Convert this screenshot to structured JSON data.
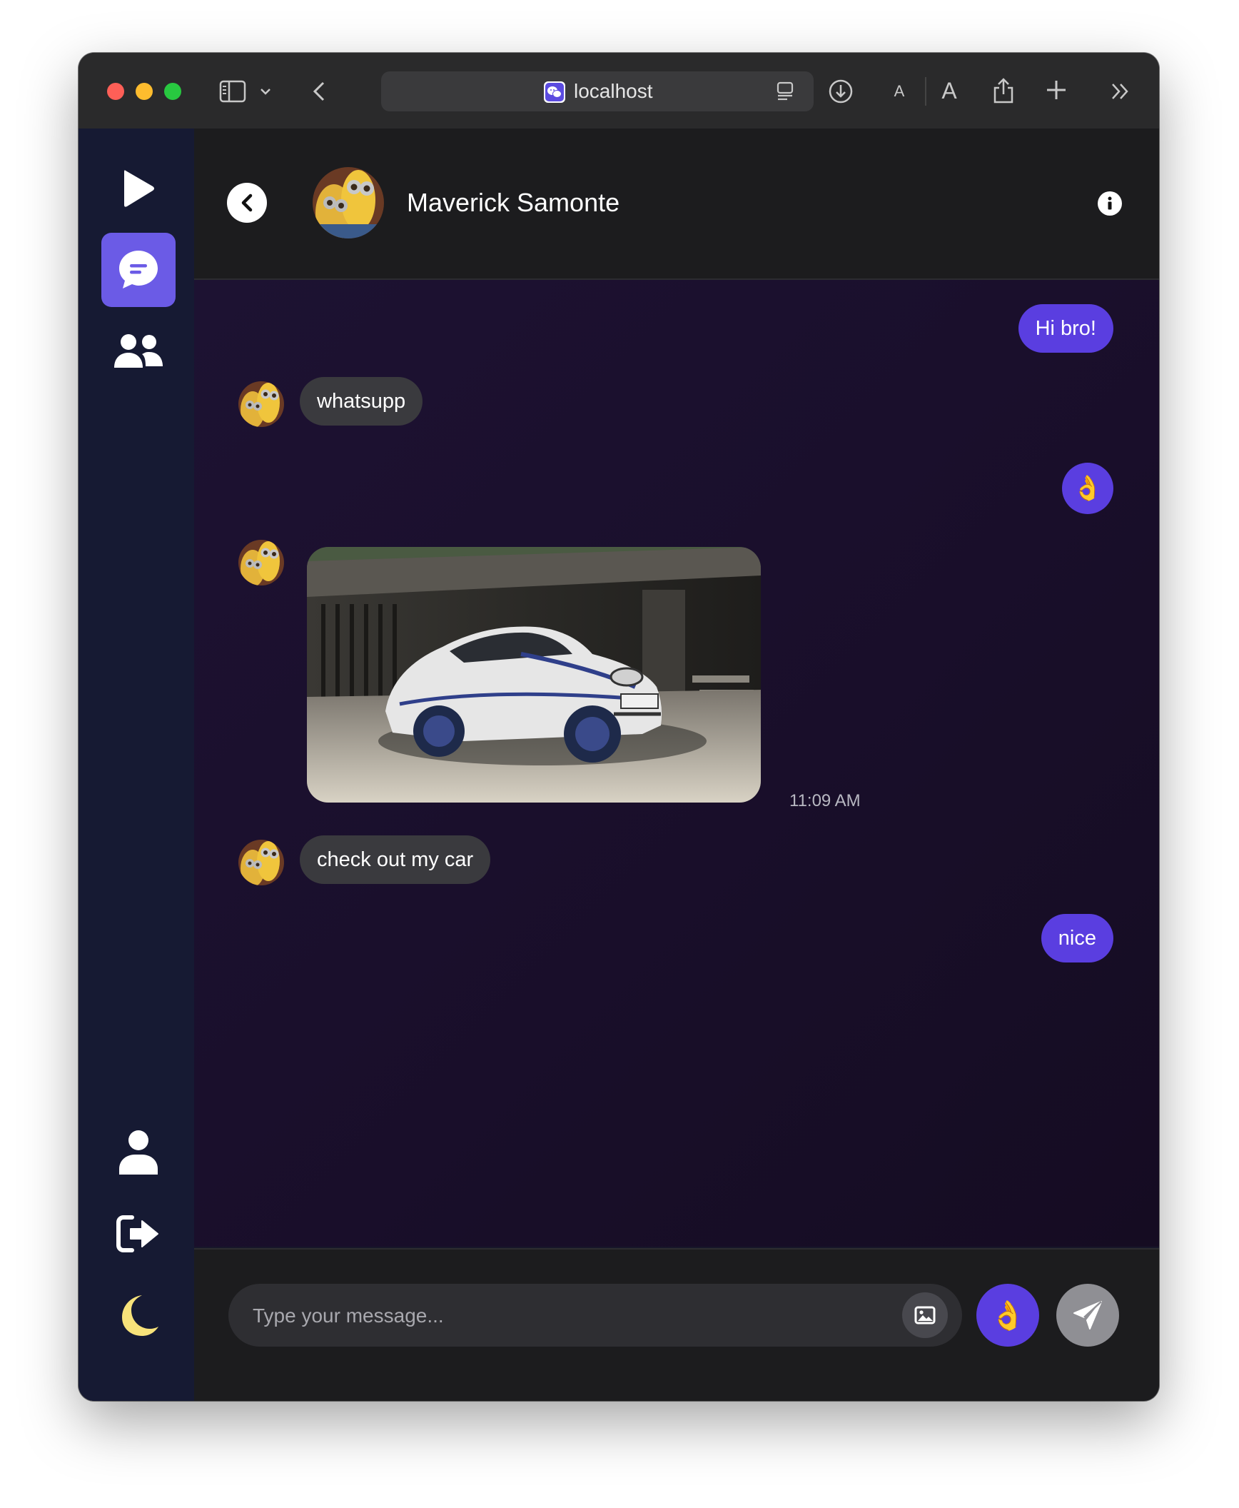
{
  "browser": {
    "url": "localhost"
  },
  "chat": {
    "contact_name": "Maverick Samonte",
    "messages": [
      {
        "sender": "me",
        "text": "Hi bro!"
      },
      {
        "sender": "them",
        "text": "whatsupp"
      },
      {
        "sender": "me",
        "emoji": "👌"
      },
      {
        "sender": "them",
        "image": "white sports car",
        "timestamp": "11:09 AM"
      },
      {
        "sender": "them",
        "text": "check out my car"
      },
      {
        "sender": "me",
        "text": "nice"
      }
    ]
  },
  "composer": {
    "placeholder": "Type your message...",
    "quick_emoji": "👌"
  },
  "colors": {
    "accent": "#5a3ee0",
    "sidebar_active": "#6b5be6",
    "sidebar_bg": "#161a33",
    "incoming_bubble": "#3a3a3e",
    "moon": "#f7e27a"
  }
}
